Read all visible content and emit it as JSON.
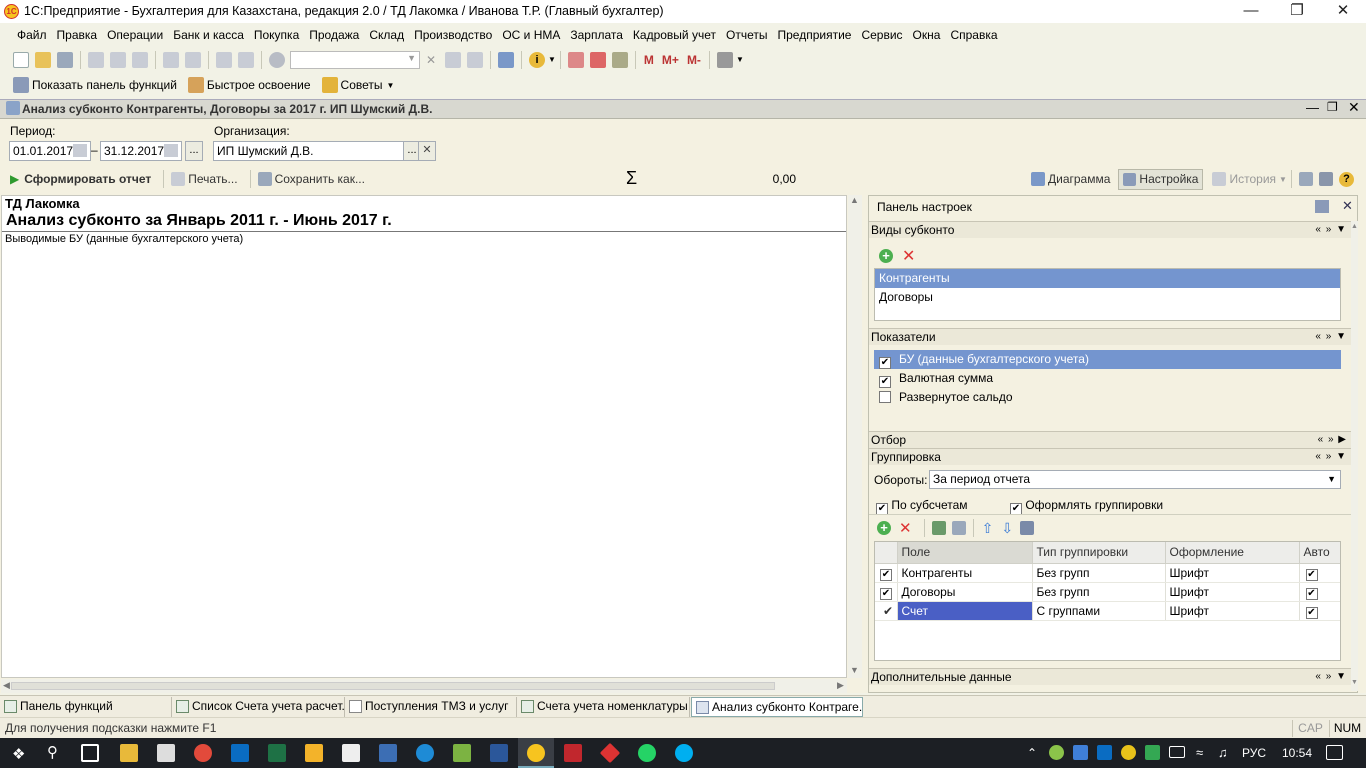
{
  "window": {
    "title": "1С:Предприятие - Бухгалтерия для Казахстана, редакция 2.0 / ТД Лакомка / Иванова Т.Р. (Главный бухгалтер)",
    "logo_text": "1С"
  },
  "menu": [
    "Файл",
    "Правка",
    "Операции",
    "Банк и касса",
    "Покупка",
    "Продажа",
    "Склад",
    "Производство",
    "ОС и НМА",
    "Зарплата",
    "Кадровый учет",
    "Отчеты",
    "Предприятие",
    "Сервис",
    "Окна",
    "Справка"
  ],
  "toolbar": {
    "m": "M",
    "m_plus": "M+",
    "m_minus": "M-",
    "search_placeholder": ""
  },
  "toolbar2": {
    "show_panel": "Показать панель функций",
    "quick_learn": "Быстрое освоение",
    "tips": "Советы"
  },
  "doc": {
    "title": "Анализ субконто Контрагенты, Договоры за 2017 г. ИП Шумский Д.В.",
    "period_label": "Период:",
    "date_from": "01.01.2017",
    "date_to": "31.12.2017",
    "date_dash": "–",
    "org_label": "Организация:",
    "org_value": "ИП Шумский Д.В.",
    "ellipsis": "...",
    "form_report": "Сформировать отчет",
    "print": "Печать...",
    "save_as": "Сохранить как...",
    "sigma": "Σ",
    "sum": "0,00",
    "diagram": "Диаграмма",
    "settings": "Настройка",
    "history": "История"
  },
  "report": {
    "company": "ТД Лакомка",
    "heading": "Анализ субконто  за Январь 2011 г. - Июнь 2017 г.",
    "subtitle": "Выводимые БУ (данные бухгалтерского учета)"
  },
  "panel": {
    "title": "Панель настроек",
    "sub_kinds_title": "Виды субконто",
    "sub_kinds": [
      "Контрагенты",
      "Договоры"
    ],
    "indicators_title": "Показатели",
    "indicators": [
      {
        "label": "БУ (данные бухгалтерского учета)",
        "checked": true,
        "selected": true
      },
      {
        "label": "Валютная сумма",
        "checked": true,
        "selected": false
      },
      {
        "label": "Развернутое сальдо",
        "checked": false,
        "selected": false
      }
    ],
    "filter_title": "Отбор",
    "grouping_title": "Группировка",
    "turnovers_label": "Обороты:",
    "turnovers_value": "За период отчета",
    "by_subaccounts": "По субсчетам",
    "format_groupings": "Оформлять группировки",
    "grid_headers": [
      "Поле",
      "Тип группировки",
      "Оформление",
      "Авто"
    ],
    "grid_rows": [
      {
        "field": "Контрагенты",
        "type": "Без групп",
        "format": "Шрифт"
      },
      {
        "field": "Договоры",
        "type": "Без групп",
        "format": "Шрифт"
      },
      {
        "field": "Счет",
        "type": "С группами",
        "format": "Шрифт"
      }
    ],
    "extra_title": "Дополнительные данные"
  },
  "wintabs": [
    "Панель функций",
    "Список Счета учета расчет...",
    "Поступления ТМЗ и услуг",
    "Счета учета номенклатуры",
    "Анализ субконто Контраге..."
  ],
  "status": {
    "hint": "Для получения подсказки нажмите F1",
    "cap": "CAP",
    "num": "NUM"
  },
  "taskbar": {
    "lang": "РУС",
    "time": "10:54"
  },
  "colors": {
    "selection": "#7495cf",
    "grid_selection": "#4a5fc5",
    "form_report_arrow": "#2e9a2e"
  }
}
